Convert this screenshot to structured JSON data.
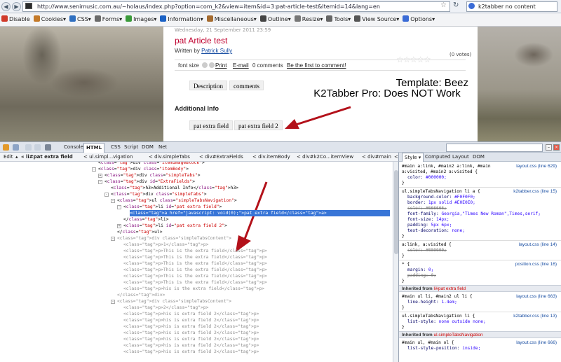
{
  "browser": {
    "url": "http://www.senimusic.com.au/~holaus/index.php?option=com_k2&view=item&id=3:pat-article-test&Itemid=14&lang=en",
    "search_text": "k2tabber no content"
  },
  "webdev_toolbar": [
    {
      "label": "Disable",
      "icon": "no-entry-icon",
      "color": "#d03a2a"
    },
    {
      "label": "Cookies",
      "icon": "cookie-icon",
      "color": "#c47a2a"
    },
    {
      "label": "CSS",
      "icon": "css-icon",
      "color": "#2f6fc0"
    },
    {
      "label": "Forms",
      "icon": "forms-icon",
      "color": "#6a6a6a"
    },
    {
      "label": "Images",
      "icon": "image-icon",
      "color": "#3a9a3a"
    },
    {
      "label": "Information",
      "icon": "info-icon",
      "color": "#1b62c5"
    },
    {
      "label": "Miscellaneous",
      "icon": "tools-icon",
      "color": "#a56b2f"
    },
    {
      "label": "Outline",
      "icon": "outline-icon",
      "color": "#444444"
    },
    {
      "label": "Resize",
      "icon": "resize-icon",
      "color": "#777777"
    },
    {
      "label": "Tools",
      "icon": "gear-icon",
      "color": "#666666"
    },
    {
      "label": "View Source",
      "icon": "source-icon",
      "color": "#555555"
    },
    {
      "label": "Options",
      "icon": "options-icon",
      "color": "#3a6bd6"
    }
  ],
  "article": {
    "date": "Wednesday, 21 September 2011 23:59",
    "title": "pat Article test",
    "written_by_label": "Written by",
    "author": "Patrick Sully",
    "votes": "(0 votes)",
    "font_size_label": "font size",
    "print_link": "Print",
    "email_link": "E-mail",
    "comments_count": "0 comments",
    "first_comment_link": "Be the first to comment!",
    "tabs": [
      "Description",
      "comments"
    ],
    "additional_info_heading": "Additional Info",
    "extra_tabs": [
      "pat extra field",
      "pat extra field 2"
    ]
  },
  "annotations": {
    "line1": "Template: Beez",
    "line2": "K2Tabber Pro: Does NOT Work",
    "arrow_color": "#b3111a"
  },
  "firebug": {
    "tabs": [
      "Console",
      "HTML",
      "CSS",
      "Script",
      "DOM",
      "Net"
    ],
    "selected_tab": "HTML",
    "edit_label": "Edit",
    "breadcrumbs": [
      "li#pat extra field",
      "ul.simpl...vigation",
      "div.simpleTabs",
      "div#ExtraFields",
      "div.itemBody",
      "div#k2Co...itemView",
      "div#main",
      "div#wrapper",
      "div#conten"
    ],
    "side_tabs": [
      "Style",
      "Computed",
      "Layout",
      "DOM"
    ],
    "html_lines": [
      {
        "indent": 0,
        "toggle": "",
        "text": "<div class=\"itemImageBlock\">",
        "gray": false,
        "selected": false
      },
      {
        "indent": 0,
        "toggle": "-",
        "text": "<div class=\"itemBody\">",
        "gray": false,
        "selected": false
      },
      {
        "indent": 1,
        "toggle": "+",
        "text": "<div class=\"simpleTabs\">",
        "gray": false,
        "selected": false
      },
      {
        "indent": 1,
        "toggle": "-",
        "text": "<div id=\"ExtraFields\">",
        "gray": false,
        "selected": false
      },
      {
        "indent": 2,
        "toggle": "",
        "text": "<h3>Additional Info</h3>",
        "gray": false,
        "selected": false
      },
      {
        "indent": 2,
        "toggle": "-",
        "text": "<div class=\"simpleTabs\">",
        "gray": false,
        "selected": false
      },
      {
        "indent": 3,
        "toggle": "-",
        "text": "<ul class=\"simpleTabsNavigation\">",
        "gray": false,
        "selected": false
      },
      {
        "indent": 4,
        "toggle": "-",
        "text": "<li id=\"pat extra field\">",
        "gray": false,
        "selected": false
      },
      {
        "indent": 5,
        "toggle": "",
        "text": "<a href=\"javascript: void(0);\">pat extra field</a>",
        "gray": false,
        "selected": true
      },
      {
        "indent": 4,
        "toggle": "",
        "text": "</li>",
        "gray": false,
        "selected": false
      },
      {
        "indent": 4,
        "toggle": "+",
        "text": "<li id=\"pat extra field 2\">",
        "gray": false,
        "selected": false
      },
      {
        "indent": 3,
        "toggle": "",
        "text": "</ul>",
        "gray": false,
        "selected": false
      },
      {
        "indent": 3,
        "toggle": "-",
        "text": "<div class=\"simpleTabsContent\">",
        "gray": true,
        "selected": false
      },
      {
        "indent": 4,
        "toggle": "",
        "text": "<p>1</p>",
        "gray": true,
        "selected": false
      },
      {
        "indent": 4,
        "toggle": "",
        "text": "<p>This is the extra field</p>",
        "gray": true,
        "selected": false
      },
      {
        "indent": 4,
        "toggle": "",
        "text": "<p>This is the extra field</p>",
        "gray": true,
        "selected": false
      },
      {
        "indent": 4,
        "toggle": "",
        "text": "<p>This is the extra field</p>",
        "gray": true,
        "selected": false
      },
      {
        "indent": 4,
        "toggle": "",
        "text": "<p>This is the extra field</p>",
        "gray": true,
        "selected": false
      },
      {
        "indent": 4,
        "toggle": "",
        "text": "<p>This is the extra field</p>",
        "gray": true,
        "selected": false
      },
      {
        "indent": 4,
        "toggle": "",
        "text": "<p>This is the extra field</p>",
        "gray": true,
        "selected": false
      },
      {
        "indent": 4,
        "toggle": "",
        "text": "<p>his is the extra field</p>",
        "gray": true,
        "selected": false
      },
      {
        "indent": 3,
        "toggle": "",
        "text": "</div>",
        "gray": true,
        "selected": false
      },
      {
        "indent": 3,
        "toggle": "-",
        "text": "<div class=\"simpleTabsContent\">",
        "gray": true,
        "selected": false
      },
      {
        "indent": 4,
        "toggle": "",
        "text": "<p>2</p>",
        "gray": true,
        "selected": false
      },
      {
        "indent": 4,
        "toggle": "",
        "text": "<p>his is extra field 2</p>",
        "gray": true,
        "selected": false
      },
      {
        "indent": 4,
        "toggle": "",
        "text": "<p>his is extra field 2</p>",
        "gray": true,
        "selected": false
      },
      {
        "indent": 4,
        "toggle": "",
        "text": "<p>his is extra field 2</p>",
        "gray": true,
        "selected": false
      },
      {
        "indent": 4,
        "toggle": "",
        "text": "<p>his is extra field 2</p>",
        "gray": true,
        "selected": false
      },
      {
        "indent": 4,
        "toggle": "",
        "text": "<p>his is extra field 2</p>",
        "gray": true,
        "selected": false
      },
      {
        "indent": 4,
        "toggle": "",
        "text": "<p>his is extra field 2</p>",
        "gray": true,
        "selected": false
      },
      {
        "indent": 4,
        "toggle": "",
        "text": "<p>his is extra field 2</p>",
        "gray": true,
        "selected": false
      }
    ],
    "css_rules": [
      {
        "kind": "selector",
        "text": "#main a:link, #main2 a:link, #main",
        "src": "layout.css (line 629)"
      },
      {
        "kind": "selector",
        "text": "a:visited, #main2 a:visited {",
        "src": ""
      },
      {
        "kind": "prop",
        "text": "color: ",
        "value": "#000000;",
        "strike": false
      },
      {
        "kind": "close",
        "text": "}"
      },
      {
        "kind": "sep"
      },
      {
        "kind": "selector",
        "text": "ul.simpleTabsNavigation li a {",
        "src": "k2tabber.css (line 15)"
      },
      {
        "kind": "prop",
        "text": "background-color: ",
        "value": "#F0F0F0;",
        "strike": false
      },
      {
        "kind": "prop",
        "text": "border: ",
        "value": "1px solid #E0E0E0;",
        "strike": false
      },
      {
        "kind": "prop",
        "text": "color: ",
        "value": "#666666;",
        "strike": true
      },
      {
        "kind": "prop",
        "text": "font-family: ",
        "value": "Georgia,\"Times New Roman\",Times,serif;",
        "strike": false
      },
      {
        "kind": "prop",
        "text": "font-size: ",
        "value": "14px;",
        "strike": false
      },
      {
        "kind": "prop",
        "text": "padding: ",
        "value": "5px 6px;",
        "strike": false
      },
      {
        "kind": "prop",
        "text": "text-decoration: ",
        "value": "none;",
        "strike": false
      },
      {
        "kind": "close",
        "text": "}"
      },
      {
        "kind": "sep"
      },
      {
        "kind": "selector",
        "text": "a:link, a:visited {",
        "src": "layout.css (line 14)"
      },
      {
        "kind": "prop",
        "text": "color: ",
        "value": "#000000;",
        "strike": true
      },
      {
        "kind": "close",
        "text": "}"
      },
      {
        "kind": "sep"
      },
      {
        "kind": "selector",
        "text": "* {",
        "src": "position.css (line 16)"
      },
      {
        "kind": "prop",
        "text": "margin: ",
        "value": "0;",
        "strike": false
      },
      {
        "kind": "prop",
        "text": "padding: ",
        "value": "0;",
        "strike": true
      },
      {
        "kind": "close",
        "text": "}"
      },
      {
        "kind": "inherit",
        "label": "Inherited from ",
        "target": "li#pat extra field"
      },
      {
        "kind": "selector",
        "text": "#main ul li, #main2 ul li {",
        "src": "layout.css (line 663)"
      },
      {
        "kind": "prop",
        "text": "line-height: ",
        "value": "1.4em;",
        "strike": false
      },
      {
        "kind": "close",
        "text": "}"
      },
      {
        "kind": "sep"
      },
      {
        "kind": "selector",
        "text": "ul.simpleTabsNavigation li {",
        "src": "k2tabber.css (line 13)"
      },
      {
        "kind": "prop",
        "text": "list-style: ",
        "value": "none outside none;",
        "strike": false
      },
      {
        "kind": "close",
        "text": "}"
      },
      {
        "kind": "inherit",
        "label": "Inherited from ",
        "target": "ul.simpleTabsNavigation"
      },
      {
        "kind": "selector",
        "text": "#main ul, #main ol {",
        "src": "layout.css (line 666)"
      },
      {
        "kind": "prop",
        "text": "list-style-position: ",
        "value": "inside;",
        "strike": false
      }
    ]
  }
}
